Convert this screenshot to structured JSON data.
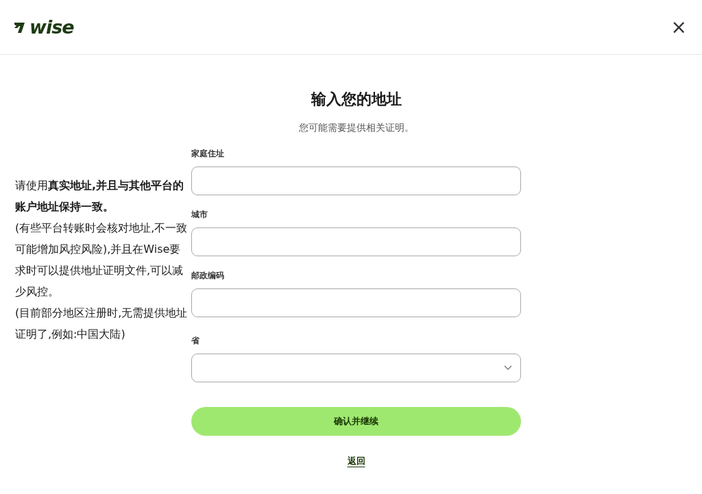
{
  "header": {
    "logo_text": "wise",
    "close": "×"
  },
  "note": "请使用**真实地址,并且与其他平台的账户地址保持一致。**\n(有些平台转账时会核对地址,不一致可能增加风控风险),并且在Wise要求时可以提供地址证明文件,可以减少风控。\n(目前部分地区注册时,无需提供地址证明了,例如:中国大陆)",
  "form": {
    "title": "输入您的地址",
    "subtitle": "您可能需要提供相关证明。",
    "fields": [
      {
        "label": "家庭住址",
        "kind": "text"
      },
      {
        "label": "城市",
        "kind": "text"
      },
      {
        "label": "邮政编码",
        "kind": "text"
      },
      {
        "label": "省",
        "kind": "select"
      }
    ],
    "submit": "确认并继续",
    "back": "返回"
  }
}
